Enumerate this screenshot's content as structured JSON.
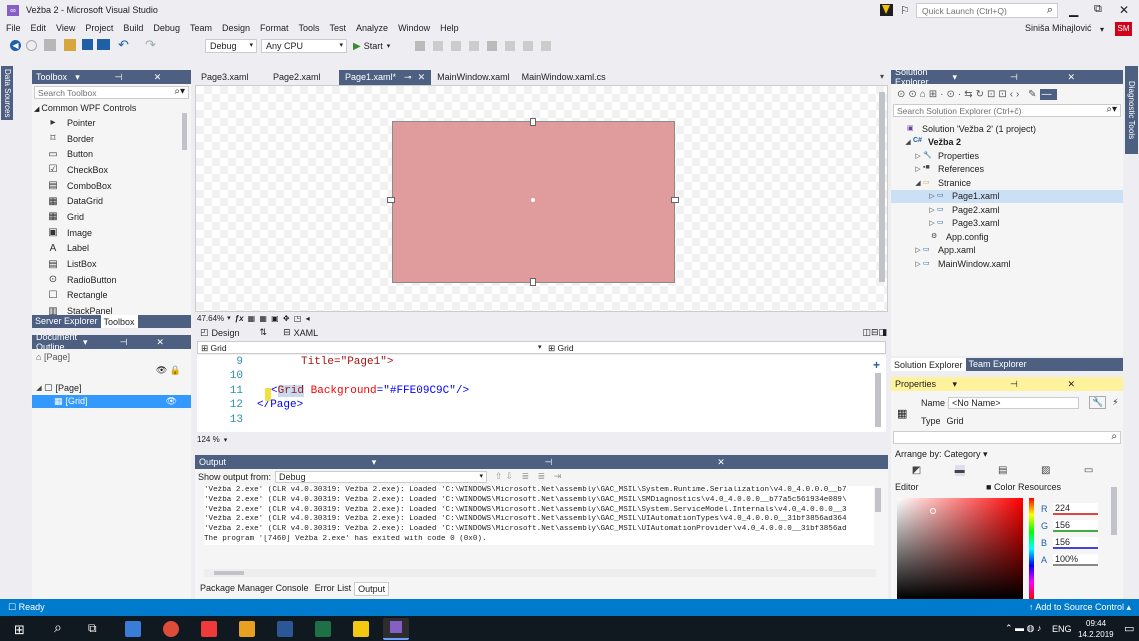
{
  "window": {
    "title": "Vežba 2 - Microsoft Visual Studio",
    "quick_launch_placeholder": "Quick Launch (Ctrl+Q)",
    "user_name": "Siniša Mihajlović",
    "user_initials": "SM"
  },
  "menu": [
    "File",
    "Edit",
    "View",
    "Project",
    "Build",
    "Debug",
    "Team",
    "Design",
    "Format",
    "Tools",
    "Test",
    "Analyze",
    "Window",
    "Help"
  ],
  "toolbar": {
    "configuration": "Debug",
    "platform": "Any CPU",
    "start_label": "Start"
  },
  "left_tab": "Data Sources",
  "right_tab": "Diagnostic Tools",
  "toolbox": {
    "title": "Toolbox",
    "search_placeholder": "Search Toolbox",
    "group": "Common WPF Controls",
    "items": [
      "Pointer",
      "Border",
      "Button",
      "CheckBox",
      "ComboBox",
      "DataGrid",
      "Grid",
      "Image",
      "Label",
      "ListBox",
      "RadioButton",
      "Rectangle",
      "StackPanel"
    ],
    "bottom_tabs": [
      "Server Explorer",
      "Toolbox"
    ]
  },
  "document_outline": {
    "title": "Document Outline",
    "page_label": "[Page]",
    "tree": [
      "[Page]",
      "[Grid]"
    ]
  },
  "editor": {
    "tabs": [
      {
        "label": "Page3.xaml",
        "active": false
      },
      {
        "label": "Page2.xaml",
        "active": false
      },
      {
        "label": "Page1.xaml*",
        "active": true
      },
      {
        "label": "MainWindow.xaml",
        "active": false
      },
      {
        "label": "MainWindow.xaml.cs",
        "active": false
      }
    ],
    "zoom": "47.64%",
    "view_tabs": [
      "Design",
      "XAML"
    ],
    "breadcrumb_left": "Grid",
    "breadcrumb_right": "Grid",
    "design_rect_color": "#e09c9c",
    "code_lines": [
      {
        "num": "9",
        "text": "Title=\"Page1\">"
      },
      {
        "num": "10",
        "text": ""
      },
      {
        "num": "11",
        "text": "<Grid Background=\"#FFE09C9C\"/>"
      },
      {
        "num": "12",
        "text": "</Page>"
      },
      {
        "num": "13",
        "text": ""
      }
    ],
    "code_zoom": "124 %"
  },
  "output": {
    "title": "Output",
    "show_from_label": "Show output from:",
    "source": "Debug",
    "lines": [
      "'Vežba 2.exe' (CLR v4.0.30319: Vežba 2.exe): Loaded 'C:\\WINDOWS\\Microsoft.Net\\assembly\\GAC_MSIL\\System.Runtime.Serialization\\v4.0_4.0.0.0__b7",
      "'Vežba 2.exe' (CLR v4.0.30319: Vežba 2.exe): Loaded 'C:\\WINDOWS\\Microsoft.Net\\assembly\\GAC_MSIL\\SMDiagnostics\\v4.0_4.0.0.0__b77a5c561934e089\\",
      "'Vežba 2.exe' (CLR v4.0.30319: Vežba 2.exe): Loaded 'C:\\WINDOWS\\Microsoft.Net\\assembly\\GAC_MSIL\\System.ServiceModel.Internals\\v4.0_4.0.0.0__3",
      "'Vežba 2.exe' (CLR v4.0.30319: Vežba 2.exe): Loaded 'C:\\WINDOWS\\Microsoft.Net\\assembly\\GAC_MSIL\\UIAutomationTypes\\v4.0_4.0.0.0__31bf3856ad364",
      "'Vežba 2.exe' (CLR v4.0.30319: Vežba 2.exe): Loaded 'C:\\WINDOWS\\Microsoft.Net\\assembly\\GAC_MSIL\\UIAutomationProvider\\v4.0_4.0.0.0__31bf3856ad",
      "The program '[7460] Vežba 2.exe' has exited with code 0 (0x0)."
    ],
    "bottom_tabs": [
      "Package Manager Console",
      "Error List",
      "Output"
    ]
  },
  "solution_explorer": {
    "title": "Solution Explorer",
    "search_placeholder": "Search Solution Explorer (Ctrl+č)",
    "tree": [
      "Solution 'Vežba 2' (1 project)",
      "Vežba 2",
      "Properties",
      "References",
      "Stranice",
      "Page1.xaml",
      "Page2.xaml",
      "Page3.xaml",
      "App.config",
      "App.xaml",
      "MainWindow.xaml"
    ],
    "bottom_tabs": [
      "Solution Explorer",
      "Team Explorer"
    ]
  },
  "properties": {
    "title": "Properties",
    "name_label": "Name",
    "name_value": "<No Name>",
    "type_label": "Type",
    "type_value": "Grid",
    "arrange_label": "Arrange by: Category",
    "editor_label": "Editor",
    "resources_label": "Color Resources",
    "r": "224",
    "g": "156",
    "b": "156",
    "a": "100%",
    "r_label": "R",
    "g_label": "G",
    "b_label": "B",
    "a_label": "A"
  },
  "status": {
    "left": "Ready",
    "right": "Add to Source Control"
  },
  "taskbar": {
    "lang": "ENG",
    "time": "09:44",
    "date": "14.2.2019"
  }
}
